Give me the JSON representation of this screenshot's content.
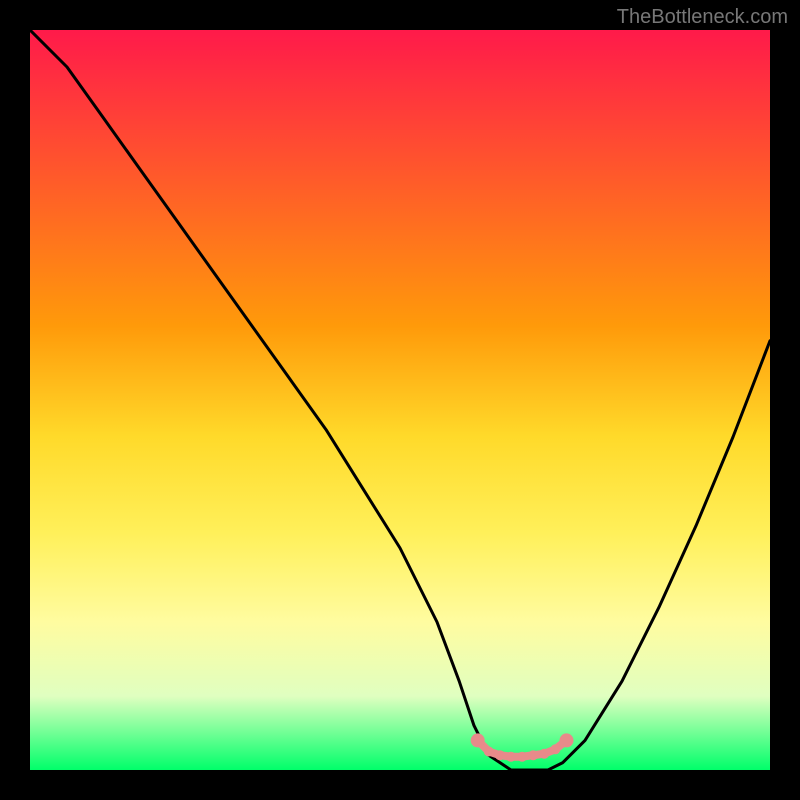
{
  "watermark": "TheBottleneck.com",
  "chart_data": {
    "type": "line",
    "title": "",
    "xlabel": "",
    "ylabel": "",
    "xlim": [
      0,
      100
    ],
    "ylim": [
      0,
      100
    ],
    "series": [
      {
        "name": "bottleneck-curve",
        "x": [
          0,
          5,
          10,
          15,
          20,
          25,
          30,
          35,
          40,
          45,
          50,
          55,
          58,
          60,
          62,
          65,
          68,
          70,
          72,
          75,
          80,
          85,
          90,
          95,
          100
        ],
        "y": [
          100,
          95,
          88,
          81,
          74,
          67,
          60,
          53,
          46,
          38,
          30,
          20,
          12,
          6,
          2,
          0,
          0,
          0,
          1,
          4,
          12,
          22,
          33,
          45,
          58
        ]
      }
    ],
    "markers": {
      "name": "minimum-band",
      "x": [
        60.5,
        62,
        63.5,
        65,
        66.5,
        68,
        69.5,
        71,
        72.5
      ],
      "y": [
        4,
        2.5,
        2,
        1.8,
        1.8,
        2,
        2.2,
        2.8,
        4
      ]
    },
    "gradient_note": "Background heat gradient: red (top, high bottleneck) → yellow → green (bottom, optimal)."
  }
}
